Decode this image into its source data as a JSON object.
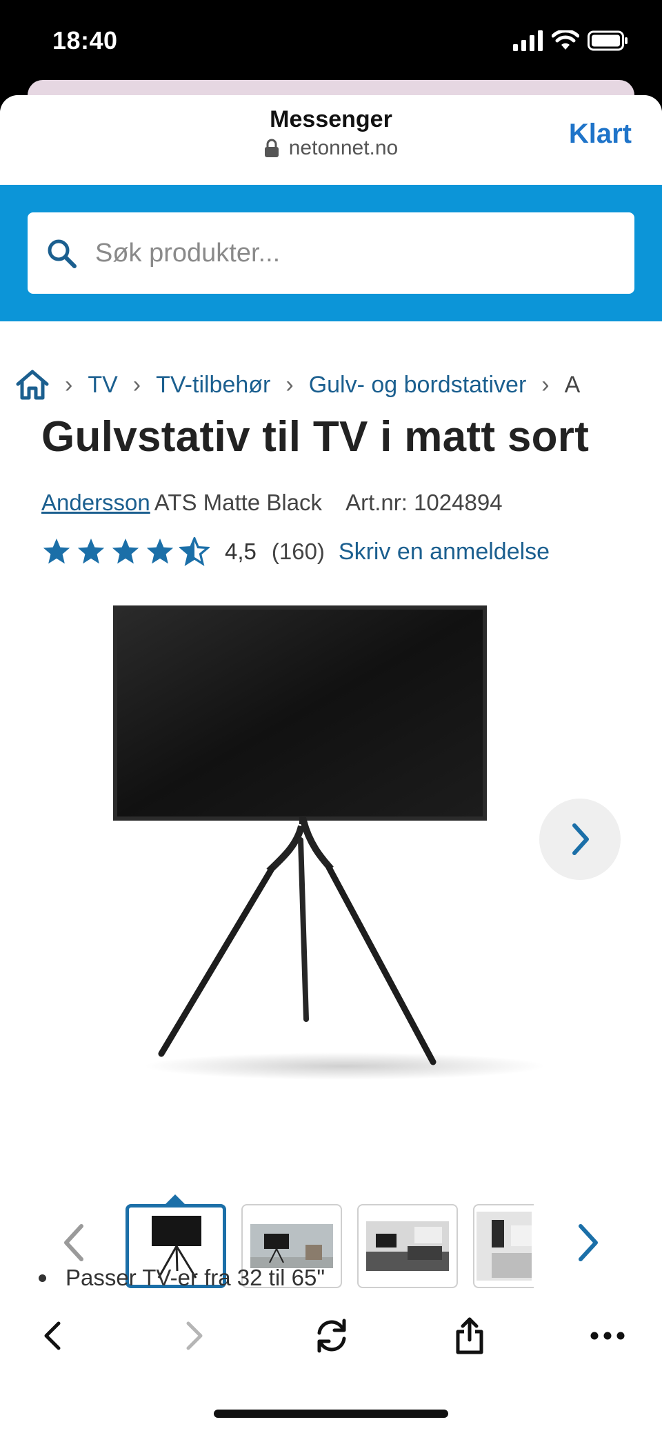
{
  "status_bar": {
    "time": "18:40"
  },
  "browser": {
    "title": "Messenger",
    "url": "netonnet.no",
    "done_label": "Klart"
  },
  "search": {
    "placeholder": "Søk produkter..."
  },
  "breadcrumb": {
    "items": [
      "TV",
      "TV-tilbehør",
      "Gulv- og bordstativer",
      "A"
    ]
  },
  "product": {
    "title": "Gulvstativ til TV i matt sort",
    "brand": "Andersson",
    "model": "ATS Matte Black",
    "article_number": "Art.nr: 1024894",
    "rating_value": "4,5",
    "rating_stars": 4.5,
    "rating_count": "(160)",
    "review_link": "Skriv en anmeldelse",
    "features": [
      "Passer TV-er fra 32 til 65\""
    ]
  },
  "thumbnails": {
    "count": 4,
    "active_index": 0
  },
  "colors": {
    "accent_blue": "#0c95d8",
    "link_blue": "#1b5f8f",
    "done_blue": "#1f74c9",
    "star": "#1b6fa8"
  },
  "icons": {
    "home": "home-icon",
    "search": "search-icon",
    "lock": "lock-icon",
    "chevron_right": "chevron-right-icon",
    "chevron_left": "chevron-left-icon",
    "star": "star-icon",
    "back": "back-icon",
    "forward": "forward-icon",
    "reload": "reload-icon",
    "share": "share-icon",
    "more": "more-icon"
  }
}
